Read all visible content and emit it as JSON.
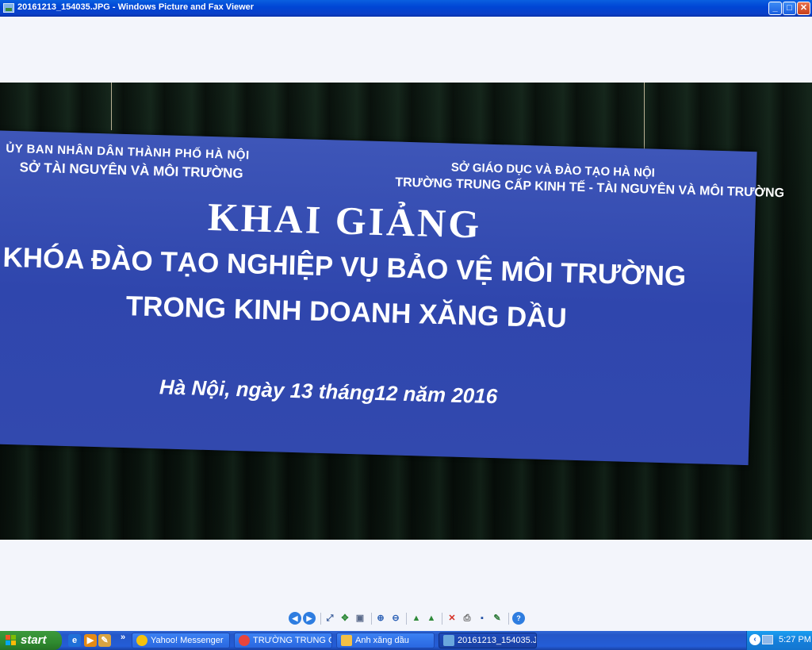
{
  "window": {
    "title": "20161213_154035.JPG - Windows Picture and Fax Viewer",
    "buttons": {
      "minimize": "_",
      "maximize": "□",
      "close": "✕"
    }
  },
  "photo": {
    "banner": {
      "org_left_line1": "ỦY BAN NHÂN DÂN THÀNH PHỐ HÀ NỘI",
      "org_left_line2": "SỞ TÀI NGUYÊN VÀ MÔI TRƯỜNG",
      "org_right_line1": "SỞ GIÁO DỤC VÀ ĐÀO TẠO HÀ NỘI",
      "org_right_line2": "TRƯỜNG TRUNG CẤP KINH TẾ - TÀI NGUYÊN VÀ MÔI TRƯỜNG",
      "heading": "KHAI GIẢNG",
      "line1": "KHÓA ĐÀO TẠO NGHIỆP VỤ BẢO VỆ MÔI TRƯỜNG",
      "line2": "TRONG KINH DOANH XĂNG DẦU",
      "date": "Hà Nội, ngày 13  tháng12 năm 2016"
    }
  },
  "toolbar": {
    "items": [
      {
        "name": "previous-image-icon",
        "glyph": "◀"
      },
      {
        "name": "next-image-icon",
        "glyph": "▶"
      },
      {
        "name": "best-fit-icon",
        "glyph": "⤢"
      },
      {
        "name": "actual-size-icon",
        "glyph": "✥"
      },
      {
        "name": "slideshow-icon",
        "glyph": "▣"
      },
      {
        "name": "zoom-in-icon",
        "glyph": "⊕"
      },
      {
        "name": "zoom-out-icon",
        "glyph": "⊖"
      },
      {
        "name": "rotate-clockwise-icon",
        "glyph": "▲"
      },
      {
        "name": "rotate-counterclockwise-icon",
        "glyph": "▲"
      },
      {
        "name": "delete-icon",
        "glyph": "✕"
      },
      {
        "name": "print-icon",
        "glyph": "⎙"
      },
      {
        "name": "save-icon",
        "glyph": "▪"
      },
      {
        "name": "edit-icon",
        "glyph": "✎"
      },
      {
        "name": "help-icon",
        "glyph": "?"
      }
    ]
  },
  "taskbar": {
    "start_label": "start",
    "quick_launch_more": "»",
    "tasks": [
      {
        "label": "Yahoo! Messenger",
        "color": "#f4c20d"
      },
      {
        "label": "TRƯỜNG TRUNG CẤP...",
        "color": "#e8453c"
      },
      {
        "label": "Anh xăng dầu",
        "color": "#f3c046"
      },
      {
        "label": "20161213_154035.J...",
        "color": "#6aa7dd"
      }
    ],
    "clock": "5:27 PM",
    "tray_chevron": "‹"
  },
  "colors": {
    "banner_blue": "#3249ae",
    "titlebar_blue": "#0a5fe0",
    "start_green": "#2f8a2f"
  }
}
